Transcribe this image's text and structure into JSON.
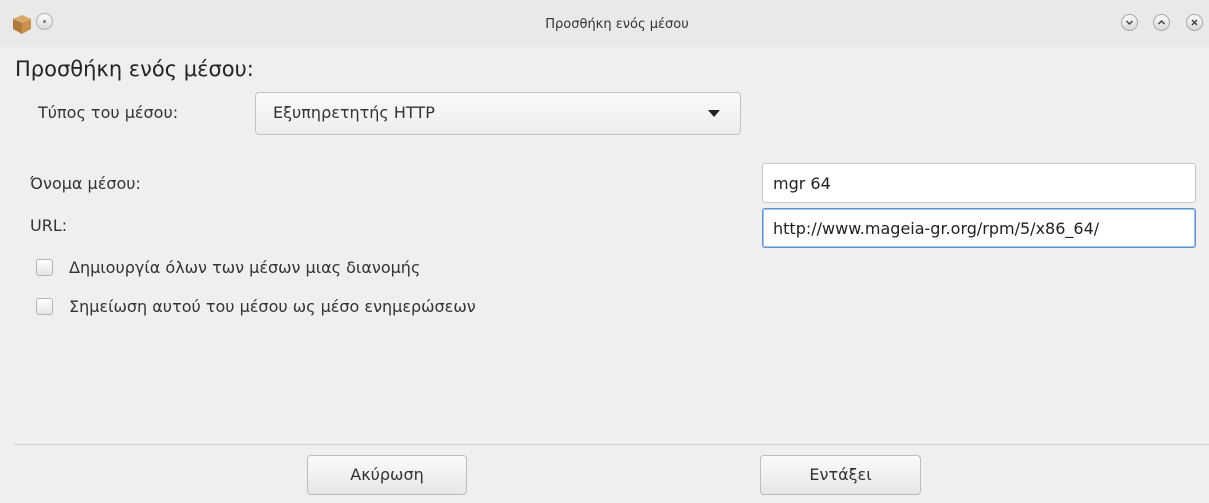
{
  "window": {
    "title": "Προσθήκη ενός μέσου",
    "icon": "package-box-icon"
  },
  "dialog": {
    "heading": "Προσθήκη ενός μέσου:",
    "media_type": {
      "label": "Τύπος του μέσου:",
      "selected": "Εξυπηρετητής HTTP"
    },
    "media_name": {
      "label": "Όνομα μέσου:",
      "value": "mgr 64"
    },
    "url": {
      "label": "URL:",
      "value": "http://www.mageia-gr.org/rpm/5/x86_64/"
    },
    "checkboxes": [
      {
        "label": "Δημιουργία όλων των μέσων μιας διανομής",
        "checked": false
      },
      {
        "label": "Σημείωση αυτού του μέσου ως μέσο ενημερώσεων",
        "checked": false
      }
    ],
    "buttons": {
      "cancel": "Ακύρωση",
      "ok": "Εντάξει"
    }
  },
  "colors": {
    "background": "#efefef",
    "focus_border": "#5a8fd0"
  }
}
